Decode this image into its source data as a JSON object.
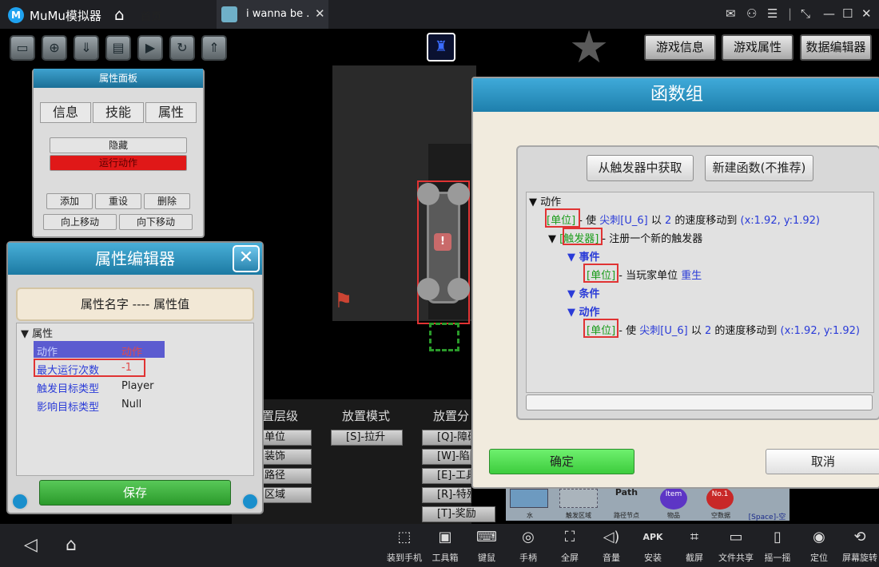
{
  "titlebar": {
    "app_name": "MuMu模拟器",
    "home_label": "首页",
    "tab_label": "i wanna be ..",
    "tab_close": "✕",
    "window_icons": [
      "mail-icon",
      "user-icon",
      "menu-icon",
      "fullscreen-icon",
      "minimize-icon",
      "maximize-icon",
      "close-icon"
    ]
  },
  "toolbar": {
    "icons": [
      "folder-icon",
      "new-file-icon",
      "download-icon",
      "save-icon",
      "play-icon",
      "refresh-icon",
      "upload-icon"
    ],
    "game_info": "游戏信息",
    "game_props": "游戏属性",
    "data_editor": "数据编辑器"
  },
  "attr_panel": {
    "title": "属性面板",
    "tabs": [
      "信息",
      "技能",
      "属性"
    ],
    "hide": "隐藏",
    "run_action": "运行动作",
    "add": "添加",
    "reset": "重设",
    "delete": "删除",
    "move_up": "向上移动",
    "move_down": "向下移动"
  },
  "prop_editor": {
    "title": "属性编辑器",
    "close": "✕",
    "name_bar": "属性名字 ---- 属性值",
    "root": "▼ 属性",
    "rows": [
      {
        "key": "动作",
        "value": "动作"
      },
      {
        "key": "最大运行次数",
        "value": "-1"
      },
      {
        "key": "触发目标类型",
        "value": "Player"
      },
      {
        "key": "影响目标类型",
        "value": "Null"
      }
    ],
    "save": "保存"
  },
  "placement": {
    "layer_head": "置层级",
    "layer_items": [
      "单位",
      "装饰",
      "路径",
      "区域"
    ],
    "mode_head": "放置模式",
    "mode_item": "[S]-拉升",
    "cat_head": "放置分",
    "cat_items": [
      "[Q]-障碍",
      "[W]-陷阱",
      "[E]-工具",
      "[R]-特殊",
      "[T]-奖励"
    ],
    "item_bar": [
      "水",
      "触发区域",
      "路径节点",
      "物品",
      "空数据",
      "[Space]-空"
    ],
    "item_glyphs": [
      "",
      "",
      "Path",
      "Item",
      "No.1"
    ]
  },
  "function_dialog": {
    "title": "函数组",
    "get_from_trigger": "从触发器中获取",
    "new_function": "新建函数(不推荐)",
    "tree": {
      "root": "▼ 动作",
      "line1": {
        "tag": "[单位]",
        "text1": " - 使 ",
        "target": "尖刺[U_6]",
        "text2": " 以 ",
        "speed": "2",
        "text3": " 的速度移动到 ",
        "coord": "(x:1.92, y:1.92)"
      },
      "line2": {
        "arrow": "▼ ",
        "tag": "[触发器]",
        "text": " - 注册一个新的触发器"
      },
      "event_head": "▼ 事件",
      "line3": {
        "tag": "[单位]",
        "text1": " - 当玩家单位 ",
        "kw": "重生"
      },
      "cond_head": "▼ 条件",
      "action_head": "▼ 动作",
      "line4": {
        "tag": "[单位]",
        "text1": " - 使 ",
        "target": "尖刺[U_6]",
        "text2": " 以 ",
        "speed": "2",
        "text3": " 的速度移动到 ",
        "coord": "(x:1.92, y:1.92)"
      }
    },
    "ok": "确定",
    "cancel": "取消"
  },
  "bottombar": {
    "nav_icons": [
      "back-icon",
      "home-icon"
    ],
    "items": [
      {
        "icon": "⬚",
        "label": "装到手机"
      },
      {
        "icon": "▣",
        "label": "工具箱"
      },
      {
        "icon": "⌨",
        "label": "键鼠"
      },
      {
        "icon": "◎",
        "label": "手柄"
      },
      {
        "icon": "⛶",
        "label": "全屏"
      },
      {
        "icon": "◁)",
        "label": "音量"
      },
      {
        "icon": "APK",
        "label": "安装"
      },
      {
        "icon": "⌗",
        "label": "截屏"
      },
      {
        "icon": "▭",
        "label": "文件共享"
      },
      {
        "icon": "▯",
        "label": "摇一摇"
      },
      {
        "icon": "◉",
        "label": "定位"
      },
      {
        "icon": "⟲",
        "label": "屏幕旋转"
      }
    ]
  },
  "colors": {
    "panel_header": "#1e7fac",
    "ok_green": "#3dcc3d",
    "highlight_red": "#e03333",
    "keyword_blue": "#2a3bd8"
  }
}
